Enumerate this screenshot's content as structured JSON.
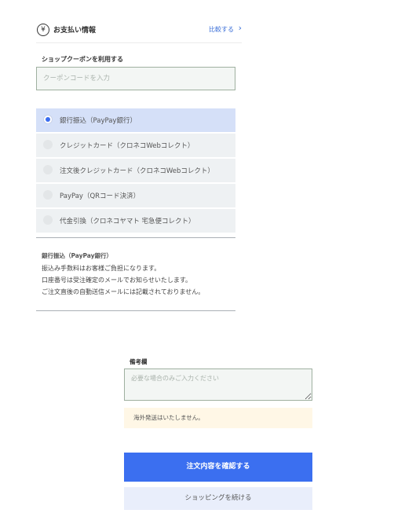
{
  "header": {
    "icon": "yen-icon",
    "title": "お支払い情報",
    "compare_link": "比較する",
    "chevron": "chevron-right-icon"
  },
  "coupon": {
    "label": "ショップクーポンを利用する",
    "placeholder": "クーポンコードを入力"
  },
  "payment_options": [
    {
      "label": "銀行振込（PayPay銀行）",
      "selected": true
    },
    {
      "label": "クレジットカード（クロネコWebコレクト）",
      "selected": false
    },
    {
      "label": "注文後クレジットカード（クロネコWebコレクト）",
      "selected": false
    },
    {
      "label": "PayPay（QRコード決済）",
      "selected": false
    },
    {
      "label": "代金引換（クロネコヤマト 宅急便コレクト）",
      "selected": false
    }
  ],
  "info": {
    "title": "銀行振込（PayPay銀行）",
    "lines": [
      "振込み手数料はお客様ご負担になります。",
      "口座番号は受注確定のメールでお知らせいたします。",
      "ご注文直後の自動送信メールには記載されておりません。"
    ]
  },
  "notes": {
    "label": "備考欄",
    "placeholder": "必要な場合のみご入力ください"
  },
  "notice": "海外発送はいたしません。",
  "buttons": {
    "confirm": "注文内容を確認する",
    "continue": "ショッピングを続ける"
  },
  "colors": {
    "accent": "#3b6ff0",
    "selected_bg": "#d5e0f8",
    "notice_bg": "#fff7e6"
  }
}
